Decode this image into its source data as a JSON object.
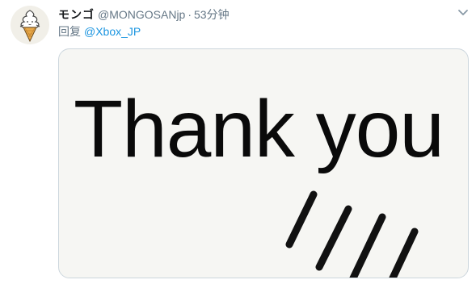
{
  "tweet": {
    "display_name": "モンゴ",
    "handle": "@MONGOSANjp",
    "separator": "·",
    "time": "53分钟",
    "reply_prefix": "回复",
    "reply_mention": "@Xbox_JP",
    "image_text": "Thank you",
    "avatar_icon": "soft-serve-ice-cream-icon",
    "menu_icon": "chevron-down-icon"
  },
  "colors": {
    "name": "#14171a",
    "secondary": "#657786",
    "link": "#1b95e0",
    "image_background": "#f6f6f3",
    "border": "#ccd6dd"
  }
}
